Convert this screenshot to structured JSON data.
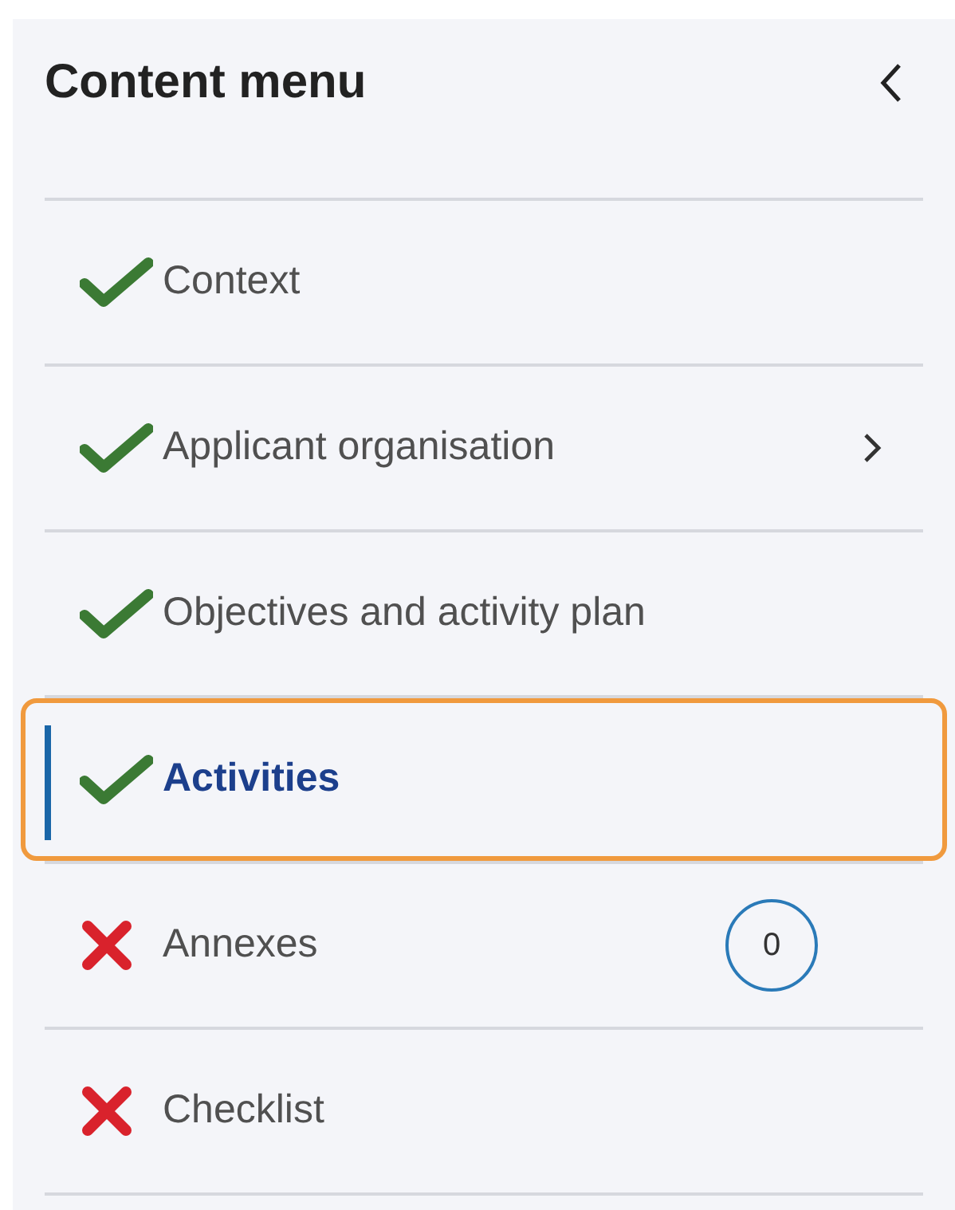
{
  "title": "Content menu",
  "items": [
    {
      "label": "Context",
      "complete": true,
      "has_submenu": false,
      "selected": false
    },
    {
      "label": "Applicant organisation",
      "complete": true,
      "has_submenu": true,
      "selected": false
    },
    {
      "label": "Objectives and activity plan",
      "complete": true,
      "has_submenu": false,
      "selected": false
    },
    {
      "label": "Activities",
      "complete": true,
      "has_submenu": false,
      "selected": true
    },
    {
      "label": "Annexes",
      "complete": false,
      "has_submenu": false,
      "selected": false,
      "count": "0"
    },
    {
      "label": "Checklist",
      "complete": false,
      "has_submenu": false,
      "selected": false
    }
  ]
}
